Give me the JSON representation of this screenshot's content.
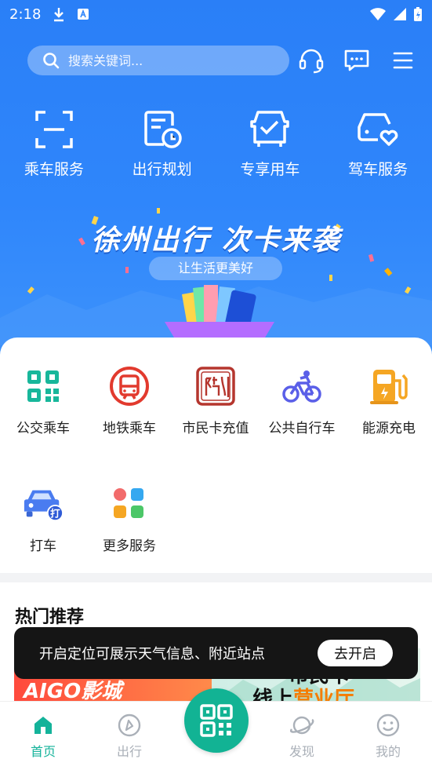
{
  "status_bar": {
    "time": "2:18"
  },
  "search": {
    "placeholder": "搜索关键词..."
  },
  "top_services": [
    {
      "label": "乘车服务",
      "icon": "scan-frame-icon"
    },
    {
      "label": "出行规划",
      "icon": "route-plan-clock-icon"
    },
    {
      "label": "专享用车",
      "icon": "car-check-icon"
    },
    {
      "label": "驾车服务",
      "icon": "car-heart-icon"
    }
  ],
  "banner": {
    "title": "徐州出行 次卡来袭",
    "subtitle": "让生活更美好"
  },
  "services": [
    {
      "label": "公交乘车",
      "icon": "qr-code-icon",
      "color": "#18b79b"
    },
    {
      "label": "地铁乘车",
      "icon": "metro-icon",
      "color": "#e23a2e"
    },
    {
      "label": "市民卡充值",
      "icon": "citizen-card-seal-icon",
      "color": "#b5362e"
    },
    {
      "label": "公共自行车",
      "icon": "bicycle-icon",
      "color": "#5a5fe8"
    },
    {
      "label": "能源充电",
      "icon": "charging-station-icon",
      "color": "#f5a623"
    },
    {
      "label": "打车",
      "icon": "taxi-icon",
      "color": "#4a7cf0"
    },
    {
      "label": "更多服务",
      "icon": "more-grid-icon",
      "color": "#4a9ff5"
    }
  ],
  "hot": {
    "title": "热门推荐",
    "promo_left": "AIGO影城",
    "promo_right_line1": "市民卡",
    "promo_right_line2_a": "线上",
    "promo_right_line2_b": "营业厅"
  },
  "toast": {
    "message": "开启定位可展示天气信息、附近站点",
    "button": "去开启"
  },
  "bottom_nav": [
    {
      "label": "首页",
      "icon": "home-icon",
      "active": true
    },
    {
      "label": "出行",
      "icon": "compass-icon",
      "active": false
    },
    {
      "label": "发现",
      "icon": "planet-icon",
      "active": false
    },
    {
      "label": "我的",
      "icon": "smile-icon",
      "active": false
    }
  ],
  "colors": {
    "primary_blue": "#2f86fb",
    "accent_green": "#12b394",
    "toast_bg": "#151515"
  }
}
